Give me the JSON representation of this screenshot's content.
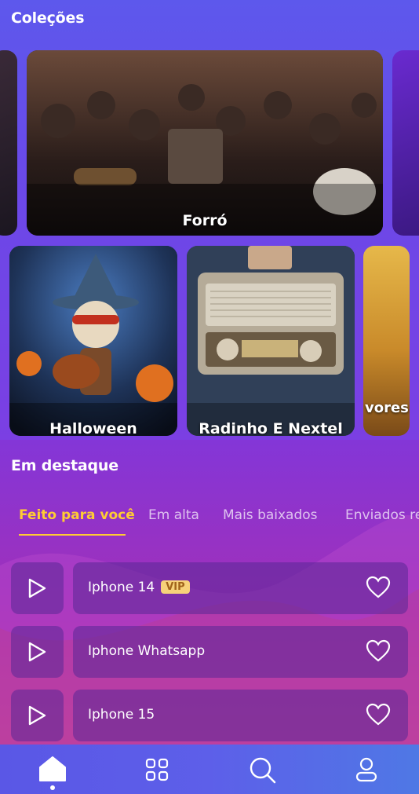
{
  "collections": {
    "title": "Coleções",
    "row1": [
      {
        "label": ""
      },
      {
        "label": "Forró"
      },
      {
        "label": ""
      }
    ],
    "row2": [
      {
        "label": "Halloween"
      },
      {
        "label": "Radinho E Nextel"
      },
      {
        "label": "vores l rangel"
      }
    ]
  },
  "featured": {
    "title": "Em destaque",
    "tabs": [
      {
        "label": "Feito para você",
        "active": true
      },
      {
        "label": "Em alta"
      },
      {
        "label": "Mais baixados"
      },
      {
        "label": "Enviados re"
      }
    ],
    "items": [
      {
        "title": "Iphone 14",
        "badge": "VIP"
      },
      {
        "title": "Iphone Whatsapp"
      },
      {
        "title": "Iphone 15"
      }
    ]
  },
  "nav": {
    "items": [
      {
        "icon": "home-icon",
        "active": true
      },
      {
        "icon": "grid-icon"
      },
      {
        "icon": "search-icon"
      },
      {
        "icon": "profile-icon"
      }
    ]
  },
  "colors": {
    "accent": "#ffcc33",
    "vip_bg": "#f7d27a"
  }
}
